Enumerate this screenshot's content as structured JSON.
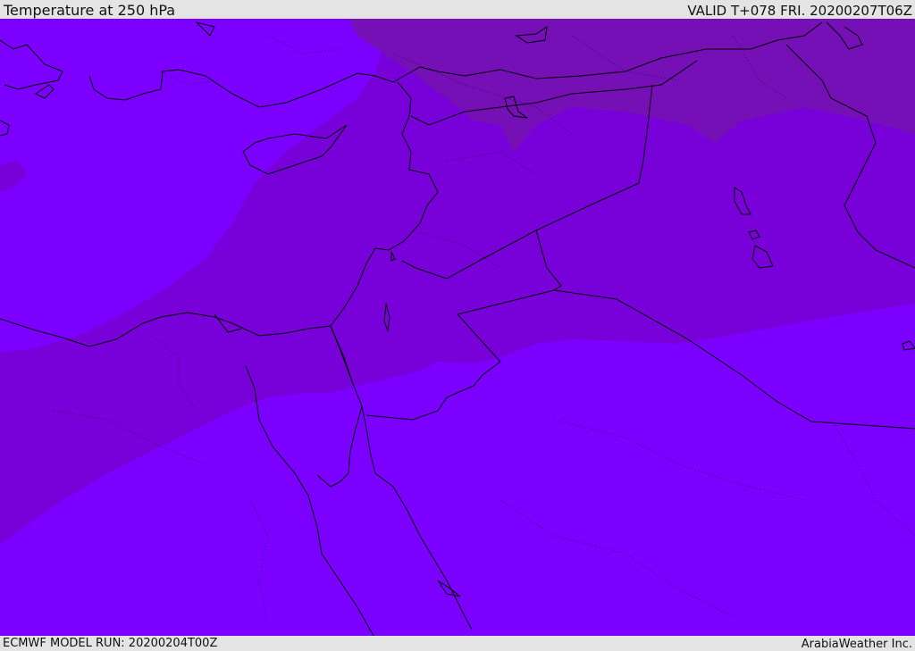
{
  "header": {
    "title": "Temperature at 250 hPa",
    "valid_time": "VALID T+078 FRI. 20200207T06Z"
  },
  "footer": {
    "model_run": "ECMWF MODEL RUN: 20200204T00Z",
    "credit": "ArabiaWeather Inc."
  },
  "map": {
    "field": "temperature",
    "level": "250 hPa",
    "colors": {
      "warmest_band": "#7c00ff",
      "middle_band": "#7800d8",
      "coolest_band": "#7410b6",
      "coastline": "#000000"
    }
  }
}
